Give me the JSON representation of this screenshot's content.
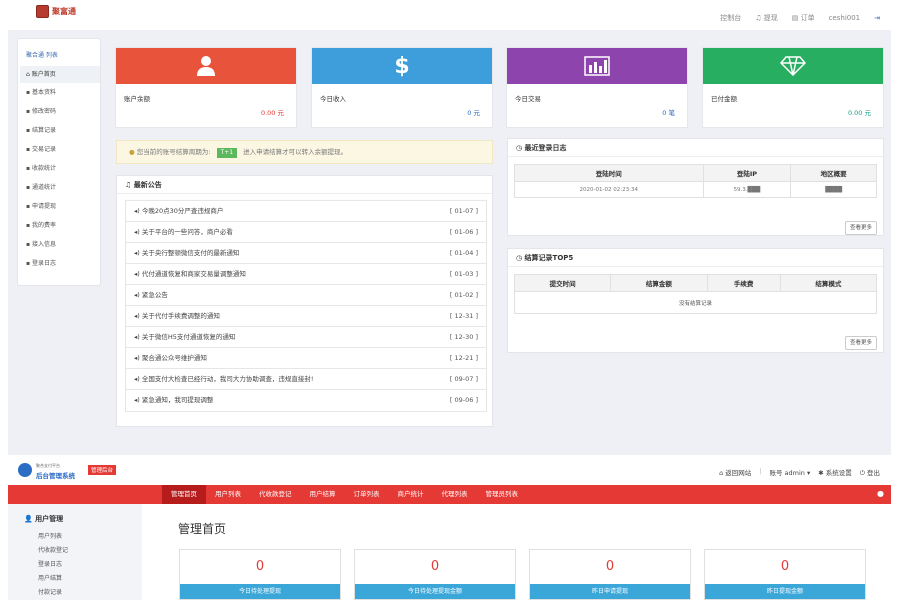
{
  "top_header": {
    "logo_text": "聚富通",
    "nav": {
      "console": "控制台",
      "withdraw": "提现",
      "orders": "订单",
      "user": "ceshi001"
    }
  },
  "sidebar": {
    "title": "聚合通 列表",
    "items": [
      "账户首页",
      "基本资料",
      "修改密码",
      "结算记录",
      "交易记录",
      "收款统计",
      "通道统计",
      "申请提现",
      "我的费率",
      "接入信息",
      "登录日志"
    ]
  },
  "cards": [
    {
      "label": "账户余额",
      "value": "0.00 元",
      "color": "#e8533b",
      "value_color": "#e53935"
    },
    {
      "label": "今日收入",
      "value": "0 元",
      "color": "#3e9ddb",
      "value_color": "#2b6cc4"
    },
    {
      "label": "今日交易",
      "value": "0 笔",
      "color": "#8e44ad",
      "value_color": "#2b6cc4"
    },
    {
      "label": "已付金额",
      "value": "0.00 元",
      "color": "#27ae60",
      "value_color": "#16a085"
    }
  ],
  "notice": {
    "before": "您当前的账号结算周期为:",
    "tag": "T+1",
    "after": "进入申请结算才可以转入余额提现。"
  },
  "announcements": {
    "title": "最新公告",
    "items": [
      {
        "text": "今晚20点30分严查违规商户",
        "date": "[ 01-07 ]"
      },
      {
        "text": "关于平台的一些问答，商户必看",
        "date": "[ 01-06 ]"
      },
      {
        "text": "关于央行整顿微信支付的最新通知",
        "date": "[ 01-04 ]"
      },
      {
        "text": "代付通道恢复和商家交易量调整通知",
        "date": "[ 01-03 ]"
      },
      {
        "text": "紧急公告",
        "date": "[ 01-02 ]"
      },
      {
        "text": "关于代付手续费调整的通知",
        "date": "[ 12-31 ]"
      },
      {
        "text": "关于微信H5支付通道恢复的通知",
        "date": "[ 12-30 ]"
      },
      {
        "text": "聚合通公众号维护通知",
        "date": "[ 12-21 ]"
      },
      {
        "text": "全国支付大检查已经行动，我司大力协助调查，违规直接封!",
        "date": "[ 09-07 ]"
      },
      {
        "text": "紧急通知，我司提现调整",
        "date": "[ 09-06 ]"
      }
    ]
  },
  "login_log": {
    "title": "最近登录日志",
    "headers": [
      "登陆时间",
      "登陆IP",
      "地区概要"
    ],
    "row": [
      "2020-01-02 02:23:34",
      "59.3.███",
      "████"
    ],
    "more": "查看更多"
  },
  "settle": {
    "title": "结算记录TOP5",
    "headers": [
      "提交时间",
      "结算金额",
      "手续费",
      "结算模式"
    ],
    "empty": "没有结算记录",
    "more": "查看更多"
  },
  "admin": {
    "logo_small": "聚合支付平台",
    "logo_main": "后台管理系统",
    "logo_tag": "管理后台",
    "right": {
      "site": "返回网站",
      "account": "账号 admin",
      "settings": "系统设置",
      "logout": "登出"
    },
    "nav": [
      "管理首页",
      "用户列表",
      "代收款登记",
      "用户结算",
      "订单列表",
      "商户统计",
      "代理列表",
      "管理员列表"
    ],
    "side_head": "用户管理",
    "side_items": [
      "用户列表",
      "代收款登记",
      "登录日志",
      "用户结算",
      "付款记录"
    ],
    "page_title": "管理首页",
    "cards": [
      {
        "num": "0",
        "label": "今日待处理提现"
      },
      {
        "num": "0",
        "label": "今日待处理提现金额"
      },
      {
        "num": "0",
        "label": "昨日申请提现"
      },
      {
        "num": "0",
        "label": "昨日提现金额"
      }
    ]
  }
}
